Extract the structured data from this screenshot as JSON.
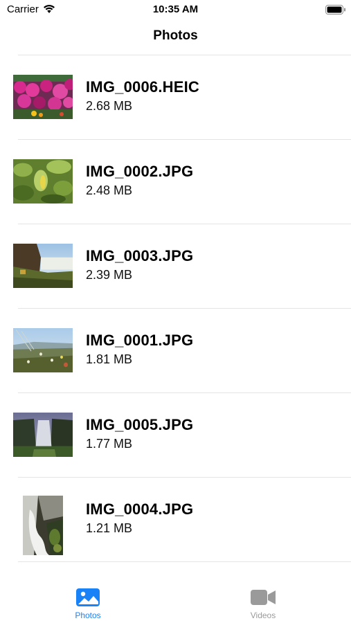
{
  "status_bar": {
    "carrier": "Carrier",
    "time": "10:35 AM"
  },
  "nav": {
    "title": "Photos"
  },
  "files": [
    {
      "name": "IMG_0006.HEIC",
      "size": "2.68 MB",
      "thumbnail": "pink-flowers"
    },
    {
      "name": "IMG_0002.JPG",
      "size": "2.48 MB",
      "thumbnail": "green-leaves"
    },
    {
      "name": "IMG_0003.JPG",
      "size": "2.39 MB",
      "thumbnail": "waterfall-coast"
    },
    {
      "name": "IMG_0001.JPG",
      "size": "1.81 MB",
      "thumbnail": "meadow-flowers"
    },
    {
      "name": "IMG_0005.JPG",
      "size": "1.77 MB",
      "thumbnail": "misty-waterfall"
    },
    {
      "name": "IMG_0004.JPG",
      "size": "1.21 MB",
      "thumbnail": "stream-rocks"
    }
  ],
  "tab_bar": {
    "tabs": [
      {
        "label": "Photos",
        "icon": "photo-icon",
        "selected": true
      },
      {
        "label": "Videos",
        "icon": "video-camera-icon",
        "selected": false
      }
    ]
  },
  "colors": {
    "accent": "#1a82f7",
    "inactive": "#9a9a9a",
    "divider": "#e4e4e7"
  }
}
